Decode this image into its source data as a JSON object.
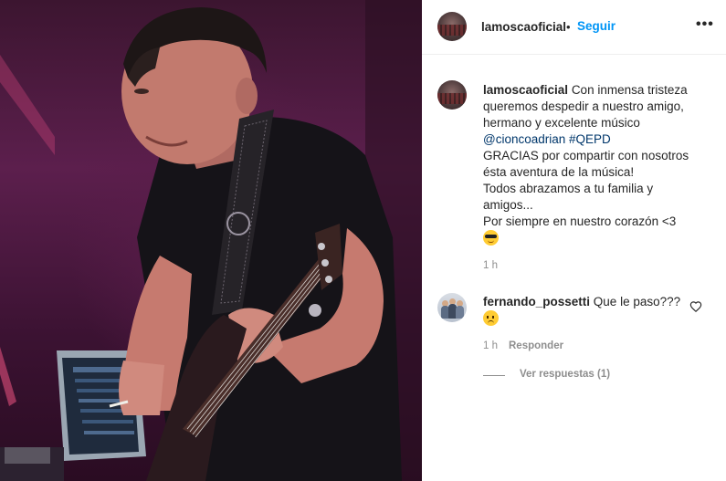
{
  "post": {
    "author": "lamoscaoficial",
    "follow_separator": "•",
    "follow_label": "Seguir",
    "more_label": "•••",
    "photo_icon": "bass-player-photo"
  },
  "caption": {
    "username": "lamoscaoficial",
    "lines": [
      "Con inmensa tristeza",
      "queremos despedir a nuestro amigo,",
      "hermano y excelente músico",
      "GRACIAS por compartir con nosotros",
      "ésta aventura de la música!",
      "Todos abrazamos a tu familia y",
      "amigos...",
      "Por siempre en nuestro corazón <3"
    ],
    "mention": "@cioncoadrian",
    "hashtag": "#QEPD",
    "emoji": "smiling-face-with-sunglasses",
    "time": "1 h"
  },
  "comments": [
    {
      "username": "fernando_possetti",
      "text": "Que le paso???",
      "emoji": "sad-relieved-face",
      "time": "1 h",
      "reply_label": "Responder",
      "view_replies": "Ver respuestas (1)",
      "like_icon": "heart-outline-icon"
    }
  ]
}
